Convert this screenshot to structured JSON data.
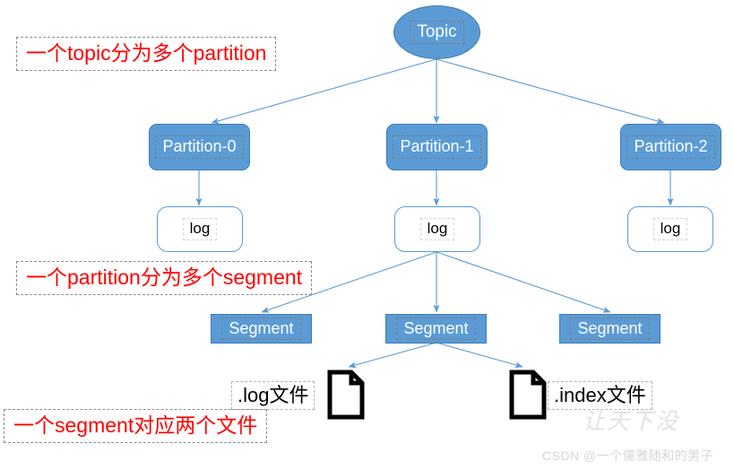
{
  "diagram": {
    "title": "Kafka Topic / Partition / Segment structure",
    "colors": {
      "node_fill_blue": "#5B9BD5",
      "node_border_blue": "#3f7cb3",
      "edge_blue": "#5B9BD5",
      "annotation_red": "#ff0000",
      "annotation_border": "#8c8c8c",
      "log_box_fill": "#ffffff",
      "watermark_gray": "#d6d6d6"
    },
    "topic": {
      "label": "Topic"
    },
    "partitions": [
      {
        "label": "Partition-0"
      },
      {
        "label": "Partition-1"
      },
      {
        "label": "Partition-2"
      }
    ],
    "logs": [
      {
        "label": "log"
      },
      {
        "label": "log"
      },
      {
        "label": "log"
      }
    ],
    "segments": [
      {
        "label": "Segment"
      },
      {
        "label": "Segment"
      },
      {
        "label": "Segment"
      }
    ],
    "files": [
      {
        "label": ".log文件",
        "icon": "document-icon"
      },
      {
        "label": ".index文件",
        "icon": "document-icon"
      }
    ],
    "annotations": [
      {
        "text": "一个topic分为多个partition"
      },
      {
        "text": "一个partition分为多个segment"
      },
      {
        "text": "一个segment对应两个文件"
      }
    ],
    "watermarks": [
      {
        "text": "CSDN @一个儒雅随和的男子"
      },
      {
        "text": "让天下没"
      }
    ]
  }
}
